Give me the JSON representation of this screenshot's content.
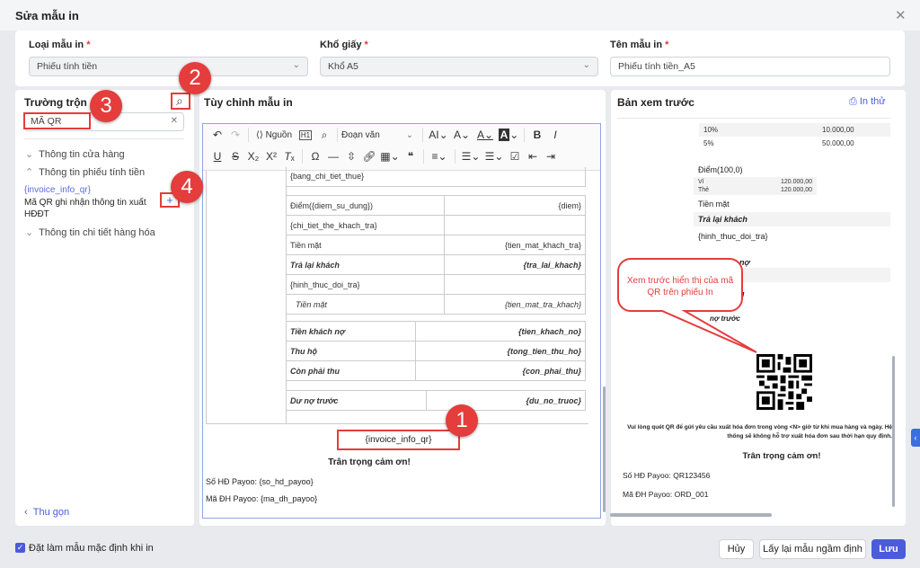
{
  "dialog": {
    "title": "Sửa mẫu in"
  },
  "fields": {
    "type": {
      "label": "Loại mẫu in",
      "value": "Phiếu tính tiền"
    },
    "paper": {
      "label": "Khổ giấy",
      "value": "Khổ A5"
    },
    "name": {
      "label": "Tên mẫu in",
      "value": "Phiếu tính tiền_A5"
    }
  },
  "left": {
    "title": "Trường trộn",
    "search_value": "MÃ QR",
    "groups": [
      {
        "label": "Thông tin cửa hàng"
      },
      {
        "label": "Thông tin phiếu tính tiền"
      },
      {
        "label": "Thông tin chi tiết hàng hóa"
      }
    ],
    "field_item": {
      "code": "{invoice_info_qr}",
      "desc": "Mã QR ghi nhận thông tin xuất HĐĐT"
    },
    "collapse": "Thu gọn"
  },
  "editor": {
    "title": "Tùy chỉnh mẫu in",
    "source_label": "Nguồn",
    "paragraph": "Đoạn văn",
    "tax_placeholder": "{bang_chi_tiet_thue}",
    "table1": [
      [
        "Điểm({diem_su_dung})",
        "{diem}"
      ],
      [
        "{chi_tiet_the_khach_tra}",
        ""
      ],
      [
        "Tiền mặt",
        "{tien_mat_khach_tra}"
      ],
      [
        "Trả lại khách",
        "{tra_lai_khach}"
      ],
      [
        "{hinh_thuc_doi_tra}",
        ""
      ],
      [
        "Tiền mặt",
        "{tien_mat_tra_khach}"
      ]
    ],
    "table2": [
      [
        "Tiền khách nợ",
        "{tien_khach_no}"
      ],
      [
        "Thu hộ",
        "{tong_tien_thu_ho}"
      ],
      [
        "Còn phải thu",
        "{con_phai_thu}"
      ]
    ],
    "table3": [
      [
        "Dư nợ trước",
        "{du_no_truoc}"
      ]
    ],
    "qr_field": "{invoice_info_qr}",
    "thanks": "Trân trọng cảm ơn!",
    "payoo_invoice": "Số HĐ Payoo: {so_hd_payoo}",
    "payoo_order": "Mã ĐH Payoo: {ma_dh_payoo}"
  },
  "preview": {
    "title": "Bản xem trước",
    "print_test": "In thử",
    "tax_rows": [
      [
        "10%",
        "10.000,00"
      ],
      [
        "5%",
        "50.000,00"
      ]
    ],
    "points": "Điểm(100,0)",
    "wallet": [
      "Ví",
      "120.000,00"
    ],
    "card": [
      "Thẻ",
      "120.000,00"
    ],
    "cash": "Tiền mặt",
    "return": "Trả lại khách",
    "exchange": "{hinh_thuc_doi_tra}",
    "debt_partial": "h nợ",
    "collect_partial": "u",
    "prev_debt_partial": "nợ trước",
    "qr_note": "Vui lòng quét QR để gửi yêu cầu xuất hóa đơn trong vòng <N> giờ từ khi mua hàng và ngày. Hệ thống sẽ không hỗ trợ xuất hóa đơn sau thời hạn quy định.",
    "thanks": "Trân trọng cảm ơn!",
    "payoo_invoice": "Số HĐ Payoo: QR123456",
    "payoo_order": "Mã ĐH Payoo: ORD_001"
  },
  "callout": "Xem trước hiển thị của mã QR trên phiếu In",
  "badges": [
    "1",
    "2",
    "3",
    "4"
  ],
  "footer": {
    "default_label": "Đặt làm mẫu mặc định khi in",
    "cancel": "Hủy",
    "reset": "Lấy lại mẫu ngầm định",
    "save": "Lưu"
  },
  "colors": {
    "accent": "#4a5bdc",
    "annotation": "#e53c3c"
  }
}
